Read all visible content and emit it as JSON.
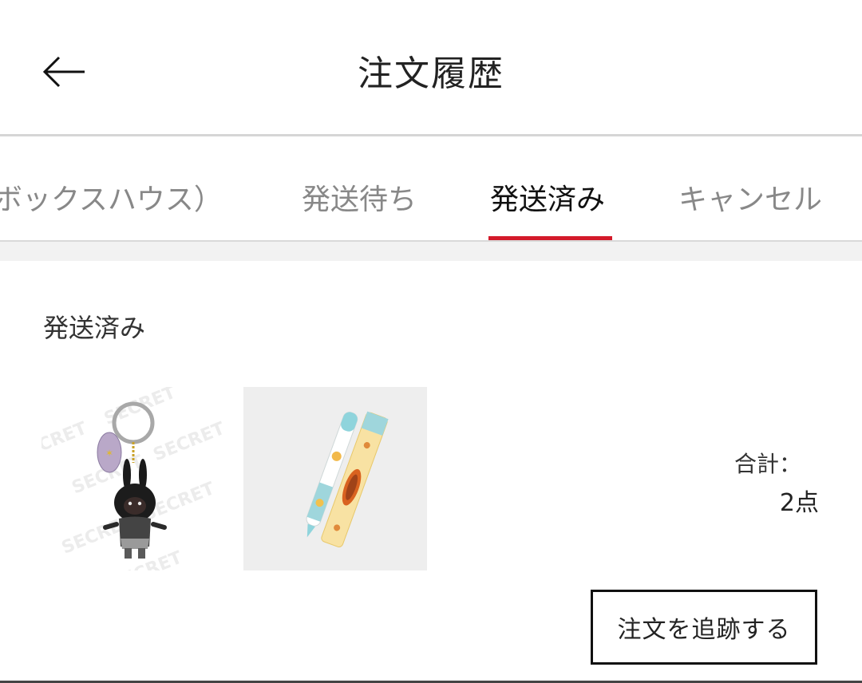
{
  "header": {
    "title": "注文履歴",
    "back_icon": "arrow-left-icon"
  },
  "tabs": [
    {
      "label": "ボックスハウス）",
      "active": false
    },
    {
      "label": "発送待ち",
      "active": false
    },
    {
      "label": "発送済み",
      "active": true
    },
    {
      "label": "キャンセル",
      "active": false
    }
  ],
  "colors": {
    "accent": "#d31a2a",
    "text": "#222222",
    "tab_inactive": "#888888"
  },
  "order": {
    "status": "発送済み",
    "items": [
      {
        "image": "black-bunny-keychain-image",
        "watermark": "SECRET"
      },
      {
        "image": "pen-in-case-image"
      }
    ],
    "total_label": "合計：",
    "total_count": "2点",
    "track_button": "注文を追跡する"
  }
}
